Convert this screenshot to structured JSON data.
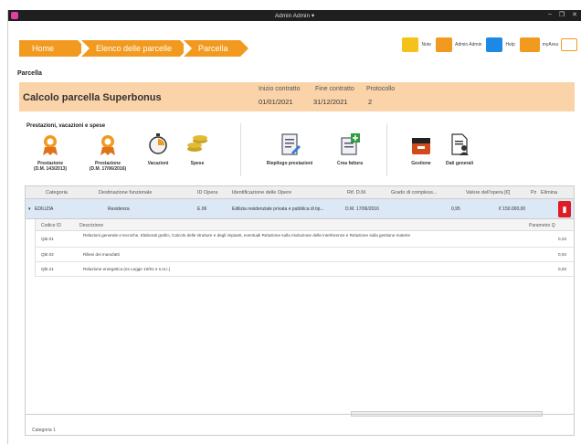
{
  "window": {
    "title": "Admin Admin ▾",
    "controls": [
      "–",
      "❐",
      "✕"
    ]
  },
  "breadcrumb": [
    "Home",
    "Elenco delle parcelle",
    "Parcella"
  ],
  "tools": {
    "note": "Note",
    "user": "Admin Admin",
    "help": "Help",
    "myarea": "myArea"
  },
  "page": {
    "section": "Parcella",
    "title": "Calcolo parcella Superbonus"
  },
  "contract": {
    "start_label": "Inizio contratto",
    "end_label": "Fine contratto",
    "protocol_label": "Protocollo",
    "start": "01/01/2021",
    "end": "31/12/2021",
    "protocol": "2"
  },
  "toolbar": {
    "group_title": "Prestazioni, vacazioni e spese",
    "btn_prest1_l1": "Prestazione",
    "btn_prest1_l2": "(D.M. 143/2013)",
    "btn_prest2_l1": "Prestazione",
    "btn_prest2_l2": "(D.M. 17/06/2016)",
    "btn_vacazioni": "Vacazioni",
    "btn_spese": "Spese",
    "btn_riepilogo": "Riepilogo prestazioni",
    "btn_crea": "Crea fattura",
    "btn_gestione": "Gestione",
    "btn_dati": "Dati generali"
  },
  "grid": {
    "columns": [
      "Categoria",
      "Destinazione funzionale",
      "ID Opera",
      "Identificazione delle Opere",
      "Rif. D.M.",
      "Grado di compless...",
      "Valore dell'opera [€]",
      "Pz",
      "Elimina"
    ],
    "row": {
      "categoria": "EDILIZIA",
      "destinazione": "Residenza",
      "id": "E.06",
      "identificazione": "Edilizia residenziale privata e pubblica di tip...",
      "rif": "D.M. 17/06/2016",
      "grado": "0,95",
      "valore": "€ 150.000,00"
    },
    "sub_columns": [
      "Codice ID",
      "Descrizione",
      "Parametro Q"
    ],
    "sub_rows": [
      {
        "code": "QbI.01",
        "desc": "Relazioni generale e tecniche, Elaborati grafici, Calcolo delle strutture e degli impianti, eventuali Relazione sulla risoluzione delle interferenze e Relazione sulla gestione materie",
        "q": "0,23"
      },
      {
        "code": "QbI.02",
        "desc": "Rilievi dei manufatti",
        "q": "0,04"
      },
      {
        "code": "QbI.21",
        "desc": "Relazione energetica (ex Legge 10/91 e s.m.i.)",
        "q": "0,03"
      }
    ]
  },
  "status": "Categoria 1"
}
